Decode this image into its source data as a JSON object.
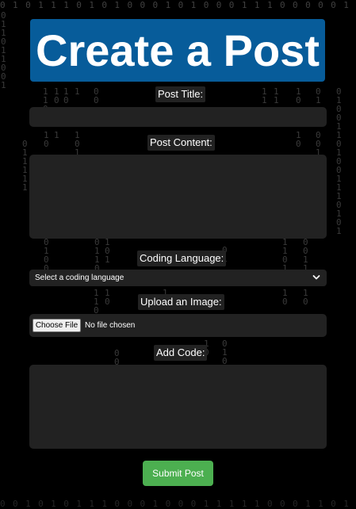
{
  "page": {
    "title": "Create a Post"
  },
  "form": {
    "post_title_label": "Post Title:",
    "post_title_value": "",
    "post_content_label": "Post Content:",
    "post_content_value": "",
    "coding_language_label": "Coding Language:",
    "coding_language_selected": "Select a coding language",
    "upload_image_label": "Upload an Image:",
    "choose_file_label": "Choose File",
    "file_status": "No file chosen",
    "add_code_label": "Add Code:",
    "add_code_value": "",
    "submit_label": "Submit Post"
  },
  "colors": {
    "background": "#000000",
    "title_box": "#075c9a",
    "field": "#222222",
    "submit": "#4caf50"
  },
  "icons": {
    "select_chevron": "chevron-down-icon"
  }
}
